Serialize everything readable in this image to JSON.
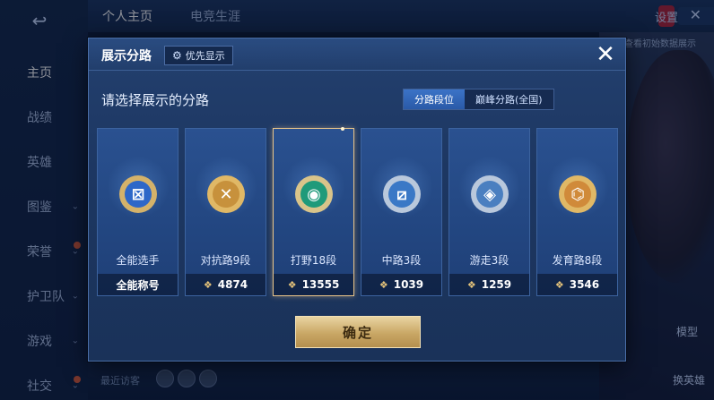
{
  "background": {
    "back_icon": "↩",
    "top_tabs": [
      "个人主页",
      "电竞生涯"
    ],
    "settings": "设置",
    "close_icon": "✕",
    "left_nav": [
      {
        "label": "主页",
        "chevron": "",
        "dot": false
      },
      {
        "label": "战绩",
        "chevron": "",
        "dot": false
      },
      {
        "label": "英雄",
        "chevron": "",
        "dot": false
      },
      {
        "label": "图鉴",
        "chevron": "⌄",
        "dot": false
      },
      {
        "label": "荣誉",
        "chevron": "⌄",
        "dot": true
      },
      {
        "label": "护卫队",
        "chevron": "⌄",
        "dot": false
      },
      {
        "label": "游戏",
        "chevron": "⌄",
        "dot": false
      },
      {
        "label": "社交",
        "chevron": "⌄",
        "dot": true
      }
    ],
    "recent_visitors": "最近访客",
    "right_data_button": "查看初始数据展示",
    "model_label": "模型",
    "swap_hero_label": "换英雄"
  },
  "modal": {
    "title": "展示分路",
    "priority_label": "优先显示",
    "gear_icon": "⚙",
    "close_icon": "✕",
    "subtitle": "请选择展示的分路",
    "segment": [
      {
        "label": "分路段位",
        "active": true
      },
      {
        "label": "巅峰分路(全国)",
        "active": false
      }
    ],
    "confirm_label": "确定"
  },
  "lanes": [
    {
      "label": "全能选手",
      "footer": "全能称号",
      "has_points": false,
      "selected": false,
      "ring_color": "#d4b26a",
      "inner_color": "#2d67c8",
      "glyph": "⊠"
    },
    {
      "label": "对抗路9段",
      "footer": "4874",
      "has_points": true,
      "selected": false,
      "ring_color": "#e0b866",
      "inner_color": "#c7913c",
      "glyph": "✕"
    },
    {
      "label": "打野18段",
      "footer": "13555",
      "has_points": true,
      "selected": true,
      "ring_color": "#d9c48a",
      "inner_color": "#1f9a7a",
      "glyph": "◉"
    },
    {
      "label": "中路3段",
      "footer": "1039",
      "has_points": true,
      "selected": false,
      "ring_color": "#b9c8dc",
      "inner_color": "#3a78c6",
      "glyph": "⧄"
    },
    {
      "label": "游走3段",
      "footer": "1259",
      "has_points": true,
      "selected": false,
      "ring_color": "#b9c8dc",
      "inner_color": "#4a7fc0",
      "glyph": "◈"
    },
    {
      "label": "发育路8段",
      "footer": "3546",
      "has_points": true,
      "selected": false,
      "ring_color": "#e0b866",
      "inner_color": "#d08a3a",
      "glyph": "⌬"
    }
  ],
  "points_icon": "❖"
}
